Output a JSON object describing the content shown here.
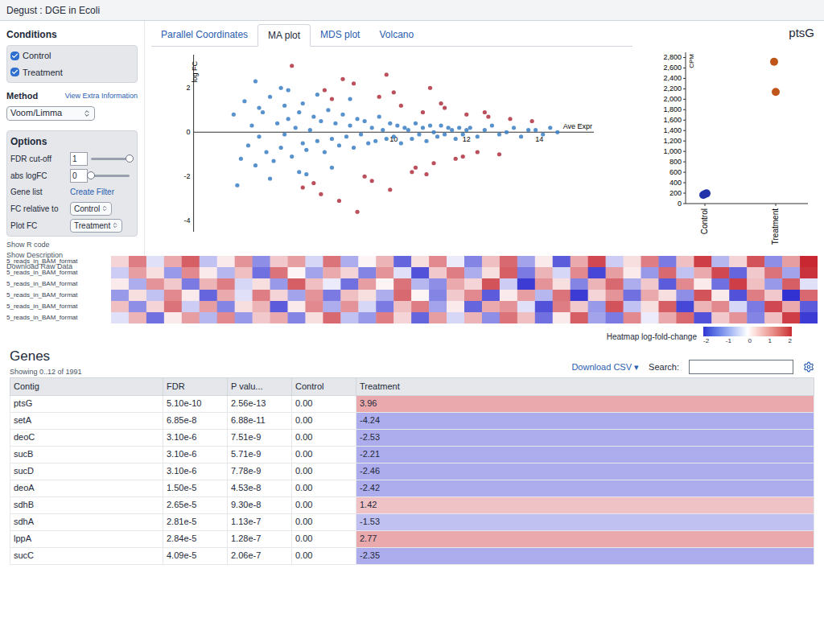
{
  "app": {
    "title": "Degust : DGE in Ecoli"
  },
  "sidebar": {
    "conditions_title": "Conditions",
    "conditions": [
      {
        "label": "Control",
        "checked": true
      },
      {
        "label": "Treatment",
        "checked": true
      }
    ],
    "method_title": "Method",
    "extra_link": "View Extra Information",
    "method": "Voom/Limma",
    "options_title": "Options",
    "options": [
      {
        "kind": "slider",
        "label": "FDR cut-off",
        "value": "1",
        "level": 1
      },
      {
        "kind": "slider",
        "label": "abs logFC",
        "value": "0",
        "level": 0
      },
      {
        "kind": "link",
        "label": "Gene list",
        "value": "Create Filter"
      },
      {
        "kind": "select",
        "label": "FC relative to",
        "value": "Control"
      },
      {
        "kind": "select",
        "label": "Plot FC",
        "value": "Treatment"
      }
    ],
    "links": [
      "Show R code",
      "Show Description",
      "Download Raw Data"
    ]
  },
  "tabs": [
    {
      "label": "Parallel Coordinates",
      "selected": false
    },
    {
      "label": "MA plot",
      "selected": true
    },
    {
      "label": "MDS plot",
      "selected": false
    },
    {
      "label": "Volcano",
      "selected": false
    }
  ],
  "ma_plot": {
    "y_label": "log FC",
    "x_label": "Ave Expr",
    "y_ticks": [
      "2",
      "0",
      "-2",
      "-4"
    ],
    "x_ticks": [
      "10",
      "12",
      "14"
    ],
    "series": [
      {
        "name": "not significant",
        "color": "#3b7fc4",
        "x": [
          5.6,
          5.8,
          5.9,
          6.0,
          6.1,
          6.2,
          6.3,
          6.3,
          6.4,
          6.5,
          6.6,
          6.7,
          6.8,
          6.9,
          7.0,
          7.0,
          7.1,
          7.2,
          7.3,
          7.4,
          7.5,
          7.5,
          7.6,
          7.7,
          7.8,
          7.9,
          8.0,
          8.1,
          8.2,
          8.3,
          8.4,
          8.5,
          8.6,
          8.7,
          8.8,
          8.9,
          9.0,
          9.1,
          9.2,
          9.3,
          9.4,
          9.5,
          9.6,
          9.7,
          9.8,
          9.9,
          10.0,
          10.1,
          10.2,
          10.3,
          10.4,
          10.5,
          10.6,
          10.7,
          10.8,
          10.9,
          11.0,
          11.1,
          11.2,
          11.3,
          11.4,
          11.5,
          11.6,
          11.7,
          11.8,
          11.9,
          12.0,
          12.1,
          12.3,
          12.5,
          12.7,
          12.9,
          13.1,
          13.3,
          13.5,
          13.7,
          13.9,
          14.1,
          14.3,
          14.5,
          6.2,
          6.6,
          7.1,
          7.4,
          7.9,
          8.3,
          5.7,
          6.9,
          7.6,
          8.8
        ],
        "y": [
          0.8,
          -1.2,
          1.4,
          -0.6,
          0.3,
          -1.5,
          1.1,
          -0.2,
          0.9,
          -0.9,
          1.6,
          -1.3,
          0.4,
          -0.7,
          1.2,
          -0.1,
          0.6,
          -1.1,
          0.2,
          0.9,
          -0.5,
          1.3,
          -0.8,
          0.1,
          0.7,
          -0.4,
          0.5,
          -0.9,
          1.0,
          -0.3,
          0.4,
          -0.6,
          0.8,
          -0.2,
          0.3,
          -0.7,
          0.6,
          -0.1,
          0.5,
          -0.5,
          0.2,
          -0.4,
          0.7,
          0.1,
          -0.3,
          0.4,
          -0.2,
          0.3,
          -0.5,
          0.2,
          0.1,
          -0.3,
          0.4,
          -0.1,
          0.2,
          -0.4,
          0.3,
          0.0,
          -0.2,
          0.3,
          -0.1,
          0.2,
          0.1,
          -0.3,
          0.2,
          -0.1,
          0.1,
          0.2,
          -0.2,
          0.1,
          0.3,
          -0.1,
          0.0,
          0.2,
          -0.2,
          0.1,
          0.1,
          -0.1,
          0.2,
          0.0,
          2.3,
          -2.1,
          1.9,
          -1.8,
          1.7,
          -1.6,
          -2.4,
          2.0,
          -1.9,
          1.5
        ]
      },
      {
        "name": "significant",
        "color": "#b0303f",
        "x": [
          7.2,
          7.8,
          8.1,
          8.5,
          8.9,
          9.2,
          9.6,
          9.9,
          10.2,
          10.5,
          10.8,
          11.1,
          11.4,
          11.7,
          12.0,
          12.3,
          12.6,
          12.9,
          13.2,
          8.0,
          8.6,
          9.4,
          10.0,
          10.6,
          11.3,
          11.9,
          12.5,
          9.0,
          9.8,
          10.9,
          8.3,
          13.8,
          7.5,
          11.0
        ],
        "y": [
          3.0,
          -2.3,
          1.9,
          -3.1,
          2.2,
          -2.0,
          1.6,
          -2.6,
          1.2,
          -1.8,
          0.9,
          -1.4,
          1.1,
          -1.2,
          0.8,
          -0.9,
          0.7,
          -1.0,
          0.6,
          -2.8,
          2.4,
          -2.2,
          1.8,
          -1.6,
          1.3,
          -1.1,
          0.9,
          -3.6,
          2.6,
          -1.9,
          1.5,
          0.5,
          -2.5,
          2.0
        ]
      }
    ]
  },
  "gene_plot": {
    "title": "ptsG",
    "y_label": "CPM",
    "y_ticks": [
      "0",
      "200",
      "400",
      "600",
      "800",
      "1,000",
      "1,200",
      "1,400",
      "1,600",
      "1,800",
      "2,000",
      "2,200",
      "2,400",
      "2,600",
      "2,800"
    ],
    "groups": [
      {
        "label": "Control",
        "color": "#2233aa",
        "values": [
          165,
          180,
          195
        ]
      },
      {
        "label": "Treatment",
        "color": "#c0551a",
        "values": [
          2720,
          2140
        ]
      }
    ]
  },
  "heatmap": {
    "row_labels": [
      "5_reads_in_BAM_format",
      "5_reads_in_BAM_format",
      "5_reads_in_BAM_format",
      "5_reads_in_BAM_format",
      "5_reads_in_BAM_format",
      "5_reads_in_BAM_format"
    ],
    "rows": [
      [
        0.4,
        1.2,
        -0.3,
        0.8,
        1.5,
        -0.6,
        0.2,
        1.0,
        -1.1,
        0.5,
        0.9,
        -0.4,
        1.3,
        -0.8,
        0.1,
        0.7,
        -1.5,
        0.3,
        1.1,
        -0.2,
        -1.2,
        0.6,
        1.4,
        -0.9,
        0.2,
        -1.6,
        0.8,
        1.7,
        -0.5,
        0.3,
        1.2,
        -1.3,
        0.6,
        1.8,
        -0.7,
        0.4,
        1.6,
        -1.1,
        0.9,
        2.0
      ],
      [
        -0.5,
        0.9,
        0.3,
        -1.0,
        1.1,
        0.2,
        -0.7,
        0.6,
        -1.4,
        1.3,
        0.1,
        -0.9,
        0.8,
        0.4,
        -1.2,
        1.0,
        -0.3,
        -1.7,
        0.5,
        1.2,
        -0.8,
        0.3,
        1.5,
        -1.3,
        0.7,
        -0.4,
        1.1,
        -1.8,
        0.9,
        0.2,
        -1.0,
        1.4,
        -0.6,
        0.8,
        1.7,
        -1.5,
        0.5,
        1.3,
        -0.9,
        1.9
      ],
      [
        0.2,
        -0.8,
        1.0,
        0.5,
        -1.3,
        0.7,
        1.2,
        -0.4,
        0.3,
        -1.0,
        1.5,
        0.6,
        -0.2,
        -1.4,
        0.9,
        0.1,
        1.3,
        -0.7,
        -1.1,
        0.8,
        0.4,
        1.6,
        -0.5,
        -1.9,
        1.0,
        0.3,
        -1.2,
        0.7,
        1.4,
        -0.8,
        0.5,
        -1.6,
        1.1,
        0.2,
        -1.4,
        1.8,
        0.6,
        -1.0,
        1.5,
        -0.3
      ],
      [
        -1.0,
        0.3,
        -0.6,
        1.1,
        0.2,
        -1.5,
        0.8,
        -0.3,
        1.2,
        0.4,
        -0.9,
        1.0,
        -1.3,
        0.6,
        0.3,
        -0.8,
        1.4,
        0.1,
        -1.2,
        0.5,
        1.1,
        -1.6,
        0.2,
        0.9,
        -0.7,
        1.3,
        -1.9,
        0.4,
        1.0,
        -1.4,
        0.8,
        0.3,
        -1.1,
        1.6,
        0.2,
        -1.7,
        1.2,
        0.5,
        -2.0,
        1.4
      ],
      [
        0.6,
        -1.1,
        0.4,
        1.3,
        -0.5,
        0.9,
        -1.2,
        0.3,
        0.7,
        -1.6,
        0.2,
        1.1,
        -0.8,
        1.0,
        -0.4,
        -1.3,
        0.6,
        1.2,
        -0.9,
        0.2,
        -1.5,
        0.8,
        1.0,
        -0.3,
        -1.7,
        1.2,
        0.5,
        -1.0,
        1.6,
        -0.6,
        0.3,
        1.5,
        -1.8,
        0.7,
        1.1,
        -0.4,
        -1.3,
        1.7,
        0.8,
        -1.6
      ],
      [
        -0.3,
        0.7,
        -1.4,
        0.2,
        0.9,
        -0.7,
        1.1,
        -1.0,
        0.5,
        0.8,
        -1.2,
        0.3,
        1.4,
        -0.6,
        -1.0,
        1.2,
        0.4,
        -1.5,
        0.9,
        -0.4,
        0.7,
        -1.1,
        1.3,
        0.6,
        -1.4,
        0.2,
        1.5,
        -0.9,
        -1.3,
        1.1,
        -0.2,
        0.8,
        1.4,
        -1.7,
        0.5,
        1.0,
        -1.2,
        0.6,
        1.8,
        -1.9
      ]
    ],
    "legend_title": "Heatmap log-fold-change",
    "legend_ticks": [
      "-2",
      "-1",
      "0",
      "1",
      "2"
    ]
  },
  "genes": {
    "title": "Genes",
    "showing": "Showing 0..12 of 1991",
    "download": "Download CSV",
    "download_caret": "▾",
    "search_label": "Search:",
    "search_value": "",
    "columns": [
      "Contig",
      "FDR",
      "P valu...",
      "Control",
      "Treatment"
    ],
    "rows": [
      {
        "contig": "ptsG",
        "fdr": "5.10e-10",
        "p": "2.56e-13",
        "control": "0.00",
        "treatment": "3.96"
      },
      {
        "contig": "setA",
        "fdr": "6.85e-8",
        "p": "6.88e-11",
        "control": "0.00",
        "treatment": "-4.24"
      },
      {
        "contig": "deoC",
        "fdr": "3.10e-6",
        "p": "7.51e-9",
        "control": "0.00",
        "treatment": "-2.53"
      },
      {
        "contig": "sucB",
        "fdr": "3.10e-6",
        "p": "5.71e-9",
        "control": "0.00",
        "treatment": "-2.21"
      },
      {
        "contig": "sucD",
        "fdr": "3.10e-6",
        "p": "7.78e-9",
        "control": "0.00",
        "treatment": "-2.46"
      },
      {
        "contig": "deoA",
        "fdr": "1.50e-5",
        "p": "4.53e-8",
        "control": "0.00",
        "treatment": "-2.42"
      },
      {
        "contig": "sdhB",
        "fdr": "2.65e-5",
        "p": "9.30e-8",
        "control": "0.00",
        "treatment": "1.42"
      },
      {
        "contig": "sdhA",
        "fdr": "2.81e-5",
        "p": "1.13e-7",
        "control": "0.00",
        "treatment": "-1.53"
      },
      {
        "contig": "lppA",
        "fdr": "2.84e-5",
        "p": "1.28e-7",
        "control": "0.00",
        "treatment": "2.77"
      },
      {
        "contig": "sucC",
        "fdr": "4.09e-5",
        "p": "2.06e-7",
        "control": "0.00",
        "treatment": "-2.35"
      }
    ]
  }
}
